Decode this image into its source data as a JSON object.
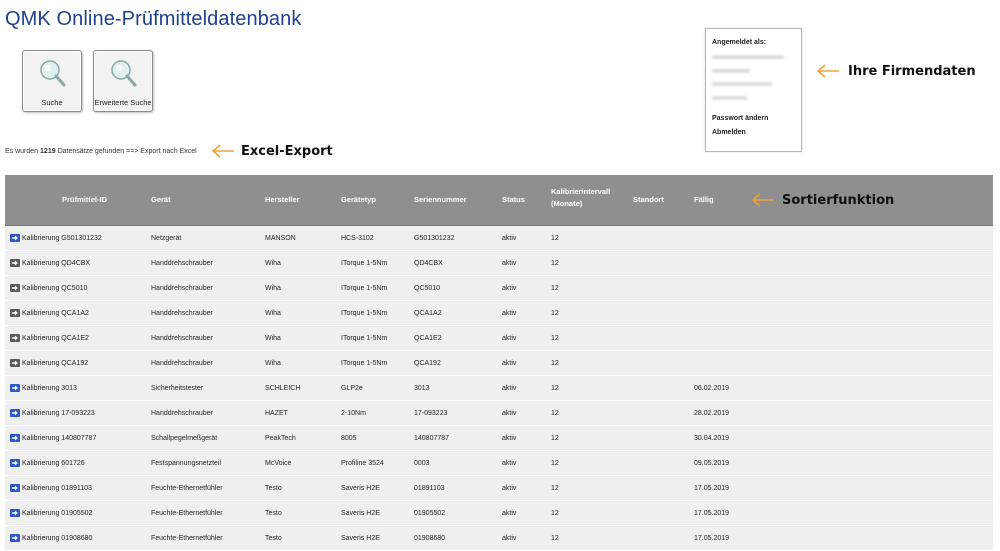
{
  "title": "QMK Online-Prüfmitteldatenbank",
  "toolbar": {
    "search_label": "Suche",
    "advanced_search_label": "Erweiterte Suche"
  },
  "login": {
    "heading": "Angemeldet als:",
    "change_password": "Passwort ändern",
    "logout": "Abmelden"
  },
  "callouts": {
    "company": "Ihre Firmendaten",
    "excel": "Excel-Export",
    "sort": "Sortierfunktion"
  },
  "colors": {
    "title": "#1f3f8f",
    "arrow": "#f0a23a",
    "header_bg": "#8f8f8f",
    "row_bg": "#efefef",
    "icon_blue": "#2b57c9",
    "icon_grey": "#5a5a5a"
  },
  "results": {
    "prefix": "Es wurden",
    "count": "1219",
    "suffix": "Datensätze gefunden",
    "arrow": "==>",
    "export_link": "Export nach Excel"
  },
  "table": {
    "headers": {
      "id": "Prüfmittel-ID",
      "geraet": "Gerät",
      "hersteller": "Hersteller",
      "typ": "Gerätetyp",
      "serien": "Seriennummer",
      "status": "Status",
      "intervall_1": "Kalibrierintervall",
      "intervall_2": "(Monate)",
      "standort": "Standort",
      "faellig": "Fällig"
    },
    "rows": [
      {
        "icon": "blue",
        "id": "Kalibrierung G501301232",
        "geraet": "Netzgerät",
        "hersteller": "MANSON",
        "typ": "HCS-3102",
        "serien": "G501301232",
        "status": "aktiv",
        "intervall": "12",
        "standort": "",
        "faellig": ""
      },
      {
        "icon": "grey",
        "id": "Kalibrierung QD4CBX",
        "geraet": "Handdrehschrauber",
        "hersteller": "Wiha",
        "typ": "ITorque 1-5Nm",
        "serien": "QD4CBX",
        "status": "aktiv",
        "intervall": "12",
        "standort": "",
        "faellig": ""
      },
      {
        "icon": "grey",
        "id": "Kalibrierung QC5010",
        "geraet": "Handdrehschrauber",
        "hersteller": "Wiha",
        "typ": "ITorque 1-5Nm",
        "serien": "QC5010",
        "status": "aktiv",
        "intervall": "12",
        "standort": "",
        "faellig": ""
      },
      {
        "icon": "grey",
        "id": "Kalibrierung QCA1A2",
        "geraet": "Handdrehschrauber",
        "hersteller": "Wiha",
        "typ": "ITorque 1-5Nm",
        "serien": "QCA1A2",
        "status": "aktiv",
        "intervall": "12",
        "standort": "",
        "faellig": ""
      },
      {
        "icon": "grey",
        "id": "Kalibrierung QCA1E2",
        "geraet": "Handdrehschrauber",
        "hersteller": "Wiha",
        "typ": "ITorque 1-5Nm",
        "serien": "QCA1E2",
        "status": "aktiv",
        "intervall": "12",
        "standort": "",
        "faellig": ""
      },
      {
        "icon": "grey",
        "id": "Kalibrierung QCA192",
        "geraet": "Handdrehschrauber",
        "hersteller": "Wiha",
        "typ": "ITorque 1-5Nm",
        "serien": "QCA192",
        "status": "aktiv",
        "intervall": "12",
        "standort": "",
        "faellig": ""
      },
      {
        "icon": "blue",
        "id": "Kalibrierung 3013",
        "geraet": "Sicherheitstester",
        "hersteller": "SCHLEICH",
        "typ": "GLP2e",
        "serien": "3013",
        "status": "aktiv",
        "intervall": "12",
        "standort": "",
        "faellig": "06.02.2019"
      },
      {
        "icon": "blue",
        "id": "Kalibrierung 17-093223",
        "geraet": "Handdrehschrauber",
        "hersteller": "HAZET",
        "typ": "2-10Nm",
        "serien": "17-093223",
        "status": "aktiv",
        "intervall": "12",
        "standort": "",
        "faellig": "28.02.2019"
      },
      {
        "icon": "blue",
        "id": "Kalibrierung 140807787",
        "geraet": "Schallpegelmeßgerät",
        "hersteller": "PeakTech",
        "typ": "8005",
        "serien": "140807787",
        "status": "aktiv",
        "intervall": "12",
        "standort": "",
        "faellig": "30.04.2019"
      },
      {
        "icon": "blue",
        "id": "Kalibrierung 601726",
        "geraet": "Festspannungsnetzteil",
        "hersteller": "McVoice",
        "typ": "Profiline 3524",
        "serien": "0003",
        "status": "aktiv",
        "intervall": "12",
        "standort": "",
        "faellig": "09.05.2019"
      },
      {
        "icon": "blue",
        "id": "Kalibrierung 01891103",
        "geraet": "Feuchte-Ethernetfühler",
        "hersteller": "Testo",
        "typ": "Saveris H2E",
        "serien": "01891103",
        "status": "aktiv",
        "intervall": "12",
        "standort": "",
        "faellig": "17.05.2019"
      },
      {
        "icon": "blue",
        "id": "Kalibrierung 01905502",
        "geraet": "Feuchte-Ethernetfühler",
        "hersteller": "Testo",
        "typ": "Saveris H2E",
        "serien": "01905502",
        "status": "aktiv",
        "intervall": "12",
        "standort": "",
        "faellig": "17.05.2019"
      },
      {
        "icon": "blue",
        "id": "Kalibrierung 01908680",
        "geraet": "Feuchte-Ethernetfühler",
        "hersteller": "Testo",
        "typ": "Saveris H2E",
        "serien": "01908680",
        "status": "aktiv",
        "intervall": "12",
        "standort": "",
        "faellig": "17.05.2019"
      }
    ]
  }
}
